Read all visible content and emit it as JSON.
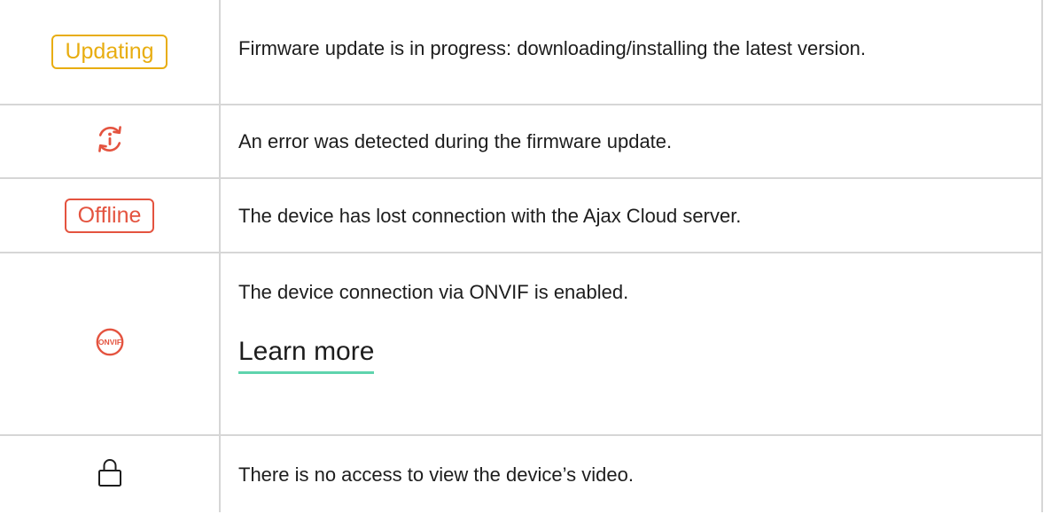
{
  "rows": [
    {
      "icon": {
        "type": "badge",
        "label": "Updating",
        "color": "#e8ad10"
      },
      "description": "Firmware update is in progress: downloading/installing the latest version."
    },
    {
      "icon": {
        "type": "icon",
        "name": "update-error-icon",
        "color": "#e4533f"
      },
      "description": "An error was detected during the firmware update."
    },
    {
      "icon": {
        "type": "badge",
        "label": "Offline",
        "color": "#e4533f"
      },
      "description": "The device has lost connection with the Ajax Cloud server."
    },
    {
      "icon": {
        "type": "icon",
        "name": "onvif-icon",
        "label": "ONVIF",
        "color": "#e4533f"
      },
      "description": "The device connection via ONVIF is enabled.",
      "link": "Learn more"
    },
    {
      "icon": {
        "type": "icon",
        "name": "lock-icon",
        "color": "#1d1d1d"
      },
      "description": "There is no access to view the device’s video."
    }
  ],
  "colors": {
    "accent_link_underline": "#5fd4ad",
    "border": "#d6d6d6"
  }
}
